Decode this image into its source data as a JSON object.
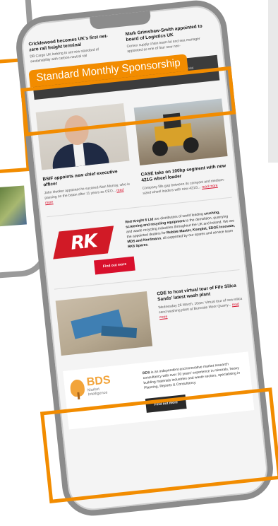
{
  "news": [
    {
      "title": "Cricklewood becomes UK's first net-zero rail freight terminal",
      "text": "DB Cargo UK looking to set new standard of sustainability with carbon-neutral rail"
    },
    {
      "title": "Mark Grimshaw-Smith appointed to board of Logistics UK",
      "text": "Cemex supply chain team-lid and sea manager appointed as one of four new non-"
    }
  ],
  "highlight_label": "Standard Monthly Sponsorship",
  "sponsor_banner_text": "BDS offer bespoke research into specific markets to support individual client needs on a confidential basis",
  "articles": [
    {
      "title": "BSIF appoints new chief executive officer",
      "text": "John Hooker appointed to succeed Alan Murray, who is passing on the baton after 11 years as CEO...",
      "link": "read more"
    },
    {
      "title": "CASE take on 100hp segment with new 421G wheel loader",
      "text": "Company fills gap between its compact and medium-sized wheel loaders with new 421G...",
      "link": "read more"
    }
  ],
  "advert": {
    "logo_text": "RK",
    "text_lead": "Red Knight 6 Ltd",
    "text_1": " are distributors of world leading ",
    "text_bold_1": "crushing, screening and recycling equipment",
    "text_2": " to the demolition, quarrying and waste recycling industries throughout the UK and Ireland. We are the appointed dealers for ",
    "text_bold_2": "Rubble Master, Komplet, EDGE Innovate, MDS and Nordmann",
    "text_3": ", all supported by our spares and service team ",
    "text_bold_3": "RK6 Spares",
    "text_4": ".",
    "button": "Find out more"
  },
  "article3": {
    "title": "CDE to host virtual tour of Fife Silica Sands' latest wash plant",
    "text": "Wednesday 26 March, 10am: Virtual tour of new silica sand washing plant at Burnside Moor Quarry...",
    "link": "read more"
  },
  "sponsor": {
    "logo_name": "BDS",
    "logo_sub_1": "Market",
    "logo_sub_2": "Intelligence",
    "text_lead": "BDS",
    "text": " is an independent and innovative market research consultancy with over 30 years' experience in minerals, heavy building materials industries and waste sectors, specialising in Planning, Reports & Consultancy.",
    "button": "Find out more"
  },
  "colors": {
    "highlight": "#f28c00",
    "accent_red": "#d8102c",
    "banner_dark": "#3c3c3c"
  }
}
